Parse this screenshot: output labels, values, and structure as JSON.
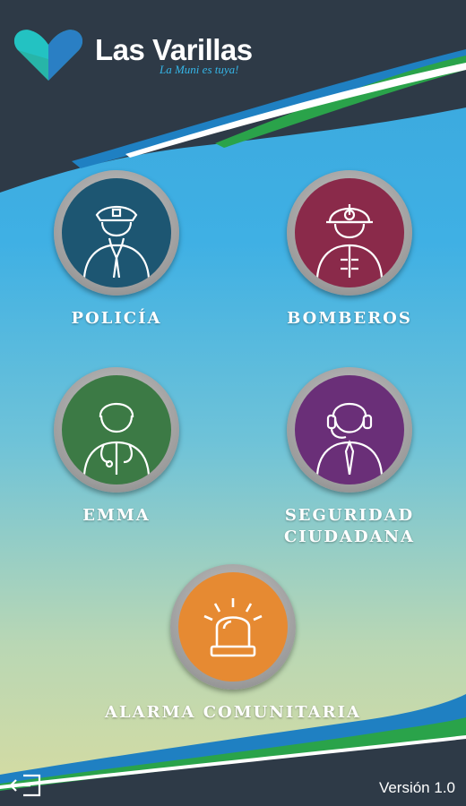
{
  "header": {
    "brand": "Las Varillas",
    "tagline": "La Muni es tuya!"
  },
  "services": [
    {
      "label": "POLICÍA",
      "icon": "police-officer-icon",
      "color": "#1d5672"
    },
    {
      "label": "BOMBEROS",
      "icon": "firefighter-icon",
      "color": "#8a2a4a"
    },
    {
      "label": "EMMA",
      "icon": "doctor-icon",
      "color": "#3c7a45"
    },
    {
      "label": "SEGURIDAD CIUDADANA",
      "icon": "operator-headset-icon",
      "color": "#6a2f78"
    },
    {
      "label": "ALARMA COMUNITARIA",
      "icon": "alarm-siren-icon",
      "color": "#e68a32"
    }
  ],
  "footer": {
    "version": "Versión 1.0",
    "exit_icon": "exit-icon"
  },
  "colors": {
    "dark": "#2e3a47",
    "accent_blue": "#1f80c2",
    "accent_green": "#2aa34a"
  }
}
